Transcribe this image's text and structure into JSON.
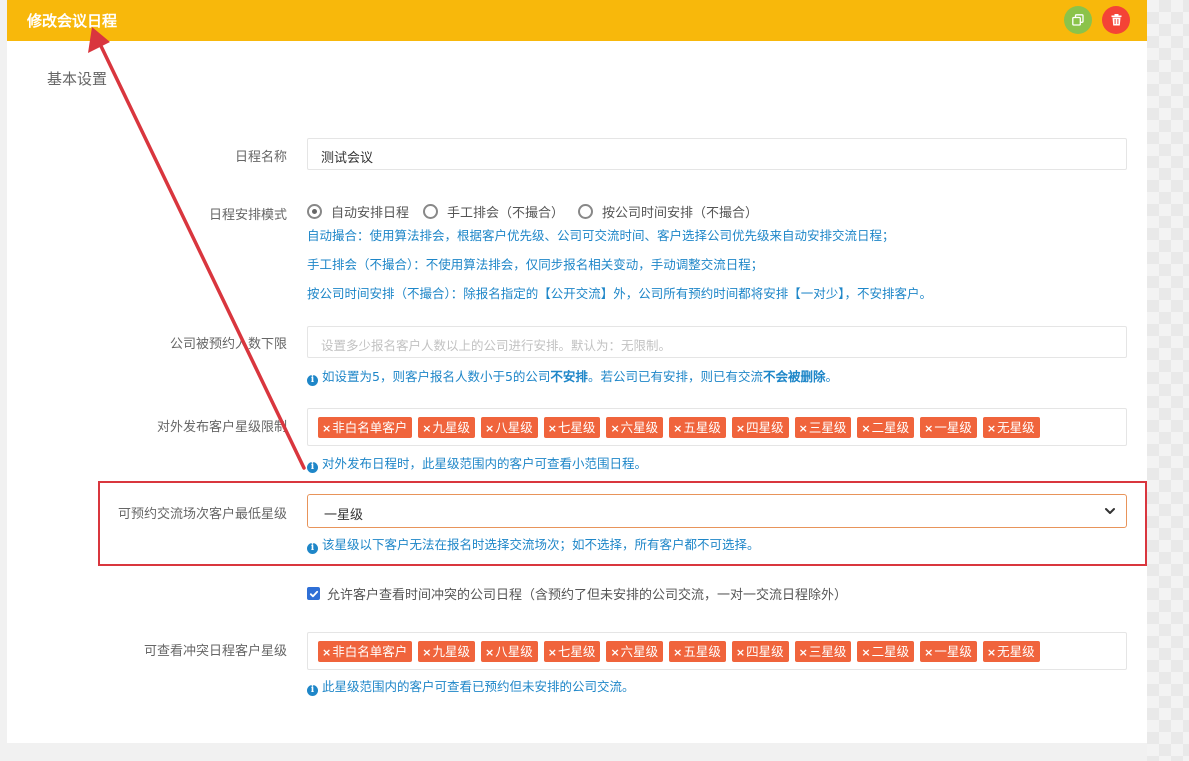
{
  "header": {
    "title": "修改会议日程",
    "copy_icon": "copy-icon",
    "delete_icon": "trash-icon",
    "accent": "#f8b80b"
  },
  "section": {
    "title": "基本设置"
  },
  "form": {
    "name": {
      "label": "日程名称",
      "value": "测试会议"
    },
    "mode": {
      "label": "日程安排模式",
      "options": [
        "自动安排日程",
        "手工排会（不撮合）",
        "按公司时间安排（不撮合）"
      ],
      "selected": "自动安排日程",
      "help": [
        "自动撮合：使用算法排会，根据客户优先级、公司可交流时间、客户选择公司优先级来自动安排交流日程；",
        "手工排会（不撮合）：不使用算法排会，仅同步报名相关变动，手动调整交流日程；",
        "按公司时间安排（不撮合）：除报名指定的【公开交流】外，公司所有预约时间都将安排【一对少】，不安排客户。"
      ]
    },
    "min_booking": {
      "label": "公司被预约人数下限",
      "placeholder": "设置多少报名客户人数以上的公司进行安排。默认为：无限制。",
      "help_pre": "如设置为5，则客户报名人数小于5的公司",
      "help_b1": "不安排",
      "help_mid": "。若公司已有安排，则已有交流",
      "help_b2": "不会被删除",
      "help_post": "。"
    },
    "publish_levels": {
      "label": "对外发布客户星级限制",
      "tags": [
        "非白名单客户",
        "九星级",
        "八星级",
        "七星级",
        "六星级",
        "五星级",
        "四星级",
        "三星级",
        "二星级",
        "一星级",
        "无星级"
      ],
      "help": "对外发布日程时，此星级范围内的客户可查看小范围日程。"
    },
    "min_star": {
      "label": "可预约交流场次客户最低星级",
      "value": "一星级",
      "help": "该星级以下客户无法在报名时选择交流场次；如不选择，所有客户都不可选择。"
    },
    "conflict_checkbox": {
      "label": "允许客户查看时间冲突的公司日程（含预约了但未安排的公司交流，一对一交流日程除外）",
      "checked": true
    },
    "conflict_levels": {
      "label": "可查看冲突日程客户星级",
      "tags": [
        "非白名单客户",
        "九星级",
        "八星级",
        "七星级",
        "六星级",
        "五星级",
        "四星级",
        "三星级",
        "二星级",
        "一星级",
        "无星级"
      ],
      "help": "此星级范围内的客户可查看已预约但未安排的公司交流。"
    }
  },
  "colors": {
    "tag": "#f0643c",
    "help": "#1e86c8",
    "annotation": "#d9363e"
  }
}
